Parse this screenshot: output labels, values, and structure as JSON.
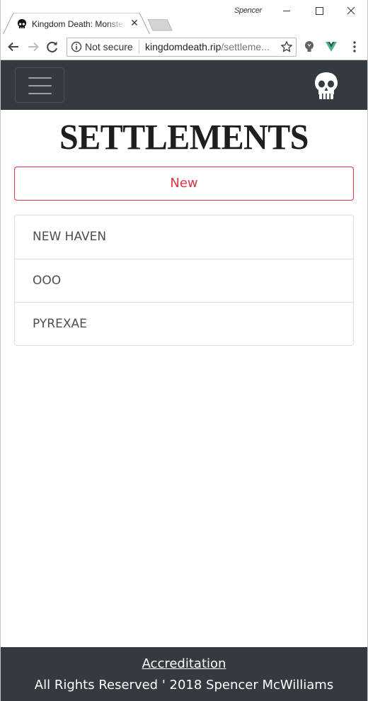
{
  "browser": {
    "tab_title": "Kingdom Death: Monster",
    "profile_name": "Spencer",
    "security_label": "Not secure",
    "url_host": "kingdomdeath.rip",
    "url_path": "/settleme..."
  },
  "site": {
    "page_title": "SETTLEMENTS",
    "new_button_label": "New",
    "settlements": [
      {
        "name": "NEW HAVEN"
      },
      {
        "name": "OOO"
      },
      {
        "name": "PYREXAE"
      }
    ],
    "footer": {
      "link_label": "Accreditation",
      "copyright": "All Rights Reserved ' 2018 Spencer McWilliams"
    }
  },
  "colors": {
    "navbar_bg": "#343a40",
    "danger": "#dc3545",
    "list_border": "#dedede",
    "footer_text": "#ffffff"
  },
  "icons": {
    "favicon": "skull-icon",
    "brand": "skull-icon",
    "window_controls": [
      "minimize-icon",
      "maximize-icon",
      "close-icon"
    ],
    "nav": [
      "back-arrow-icon",
      "forward-arrow-icon",
      "reload-icon"
    ],
    "omnibox": [
      "info-icon",
      "star-icon"
    ],
    "extensions": [
      "lightbulb-extension-icon",
      "vue-devtools-icon"
    ],
    "menu": "kebab-menu-icon"
  }
}
